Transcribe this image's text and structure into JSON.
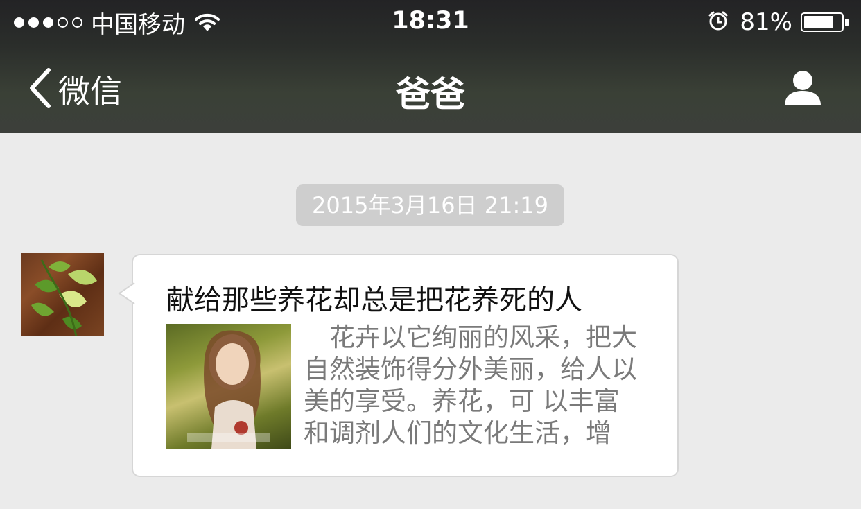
{
  "status_bar": {
    "carrier": "中国移动",
    "time": "18:31",
    "battery_percent": "81%",
    "battery_level": 0.81,
    "signal_bars_filled": 3,
    "signal_bars_total": 5
  },
  "nav": {
    "back_label": "微信",
    "title": "爸爸",
    "right_icon": "person-icon"
  },
  "chat": {
    "timestamp": "2015年3月16日 21:19",
    "message": {
      "article_title": "献给那些养花却总是把花养死的人",
      "excerpt_lines": [
        "　花卉以它绚丽的风采，把大",
        "自然装饰得分外美丽，给人以",
        "美的享受。养花，可 以丰富",
        "和调剂人们的文化生活，增"
      ]
    }
  },
  "colors": {
    "nav_bg": "#3a4036",
    "chat_bg": "#ebebeb",
    "timestamp_bg": "#cecece",
    "bubble_bg": "#ffffff",
    "excerpt_text": "#7a7a7a"
  }
}
